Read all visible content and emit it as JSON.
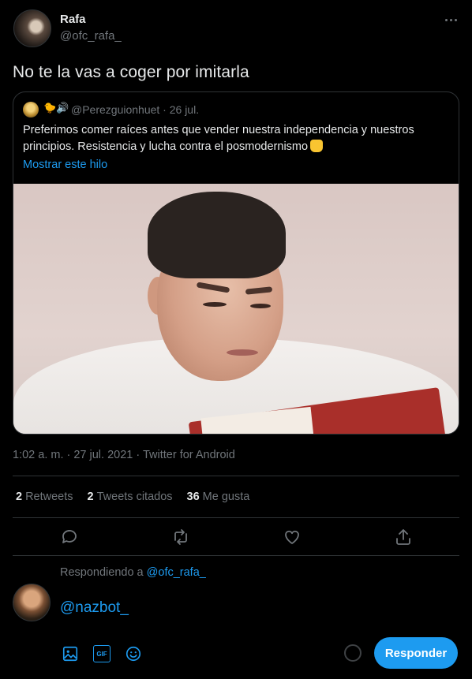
{
  "tweet": {
    "author_name": "Rafa",
    "author_handle": "@ofc_rafa_",
    "text": "No te la vas a coger por imitarla",
    "timestamp": "1:02 a. m. · 27 jul. 2021 · Twitter for Android"
  },
  "quote": {
    "handle_date": "@Perezguionhuet · 26 jul.",
    "emoji_name": "🐤🔊",
    "text": "Preferimos comer raíces antes que vender nuestra independencia y nuestros principios. Resistencia y lucha contra el posmodernismo",
    "show_thread": "Mostrar este hilo"
  },
  "stats": {
    "retweets_count": "2",
    "retweets_label": "Retweets",
    "quotes_count": "2",
    "quotes_label": "Tweets citados",
    "likes_count": "36",
    "likes_label": "Me gusta"
  },
  "reply": {
    "replying_prefix": "Respondiendo a",
    "replying_handle": "@ofc_rafa_",
    "input_value": "@nazbot_",
    "button_label": "Responder",
    "gif_label": "GIF"
  },
  "colors": {
    "accent": "#1d9bf0",
    "background": "#000000",
    "muted": "#71767b"
  }
}
